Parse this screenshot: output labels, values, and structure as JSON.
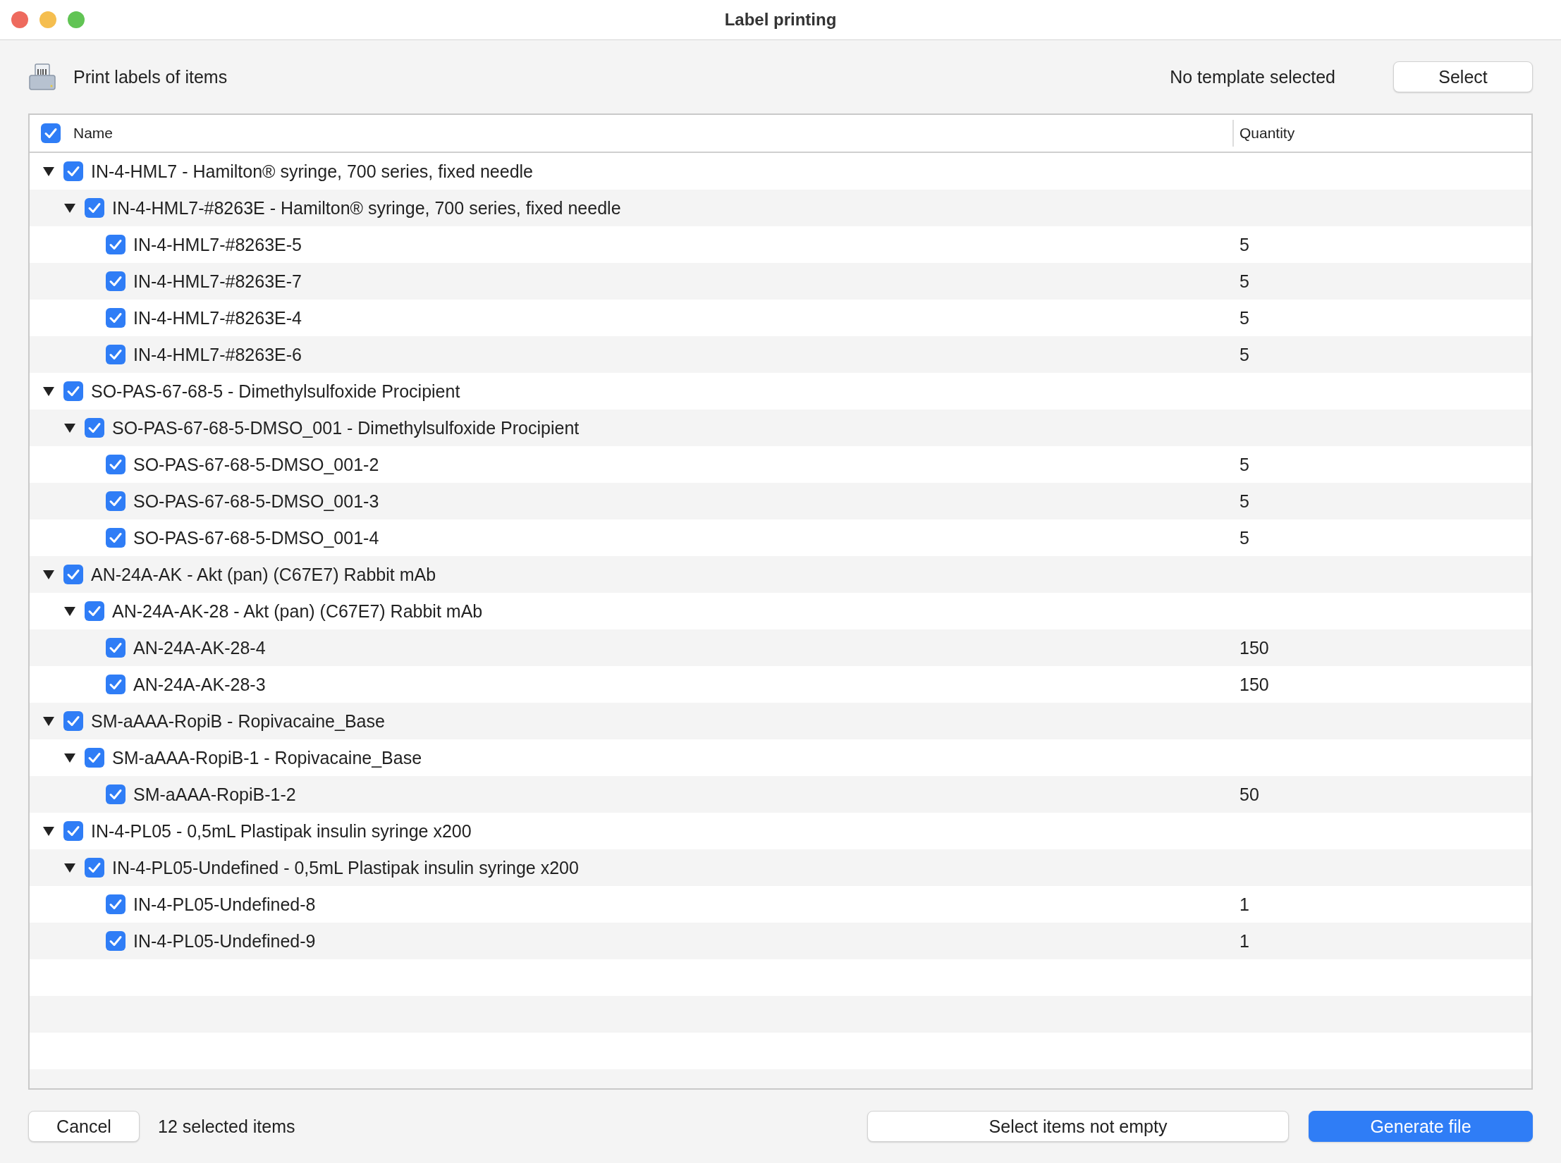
{
  "window": {
    "title": "Label printing"
  },
  "header": {
    "title": "Print labels of items",
    "template_status": "No template selected",
    "select_button": "Select"
  },
  "table": {
    "select_all_checked": true,
    "columns": [
      "Name",
      "Quantity"
    ],
    "rows": [
      {
        "label": "IN-4-HML7 - Hamilton® syringe, 700 series, fixed needle",
        "checked": true,
        "expanded": true,
        "children": [
          {
            "label": "IN-4-HML7-#8263E - Hamilton® syringe, 700 series, fixed needle",
            "checked": true,
            "expanded": true,
            "children": [
              {
                "label": "IN-4-HML7-#8263E-5",
                "checked": true,
                "quantity": "5"
              },
              {
                "label": "IN-4-HML7-#8263E-7",
                "checked": true,
                "quantity": "5"
              },
              {
                "label": "IN-4-HML7-#8263E-4",
                "checked": true,
                "quantity": "5"
              },
              {
                "label": "IN-4-HML7-#8263E-6",
                "checked": true,
                "quantity": "5"
              }
            ]
          }
        ]
      },
      {
        "label": "SO-PAS-67-68-5 - Dimethylsulfoxide Procipient",
        "checked": true,
        "expanded": true,
        "children": [
          {
            "label": "SO-PAS-67-68-5-DMSO_001 - Dimethylsulfoxide Procipient",
            "checked": true,
            "expanded": true,
            "children": [
              {
                "label": "SO-PAS-67-68-5-DMSO_001-2",
                "checked": true,
                "quantity": "5"
              },
              {
                "label": "SO-PAS-67-68-5-DMSO_001-3",
                "checked": true,
                "quantity": "5"
              },
              {
                "label": "SO-PAS-67-68-5-DMSO_001-4",
                "checked": true,
                "quantity": "5"
              }
            ]
          }
        ]
      },
      {
        "label": "AN-24A-AK - Akt (pan) (C67E7) Rabbit mAb",
        "checked": true,
        "expanded": true,
        "children": [
          {
            "label": "AN-24A-AK-28 - Akt (pan) (C67E7) Rabbit mAb",
            "checked": true,
            "expanded": true,
            "children": [
              {
                "label": "AN-24A-AK-28-4",
                "checked": true,
                "quantity": "150"
              },
              {
                "label": "AN-24A-AK-28-3",
                "checked": true,
                "quantity": "150"
              }
            ]
          }
        ]
      },
      {
        "label": "SM-aAAA-RopiB - Ropivacaine_Base",
        "checked": true,
        "expanded": true,
        "children": [
          {
            "label": "SM-aAAA-RopiB-1 - Ropivacaine_Base",
            "checked": true,
            "expanded": true,
            "children": [
              {
                "label": "SM-aAAA-RopiB-1-2",
                "checked": true,
                "quantity": "50"
              }
            ]
          }
        ]
      },
      {
        "label": "IN-4-PL05 - 0,5mL Plastipak insulin syringe x200",
        "checked": true,
        "expanded": true,
        "children": [
          {
            "label": "IN-4-PL05-Undefined - 0,5mL Plastipak insulin syringe x200",
            "checked": true,
            "expanded": true,
            "children": [
              {
                "label": "IN-4-PL05-Undefined-8",
                "checked": true,
                "quantity": "1"
              },
              {
                "label": "IN-4-PL05-Undefined-9",
                "checked": true,
                "quantity": "1"
              }
            ]
          }
        ]
      }
    ]
  },
  "footer": {
    "cancel_button": "Cancel",
    "selection_count": "12 selected items",
    "select_not_empty_button": "Select items not empty",
    "generate_button": "Generate file"
  }
}
